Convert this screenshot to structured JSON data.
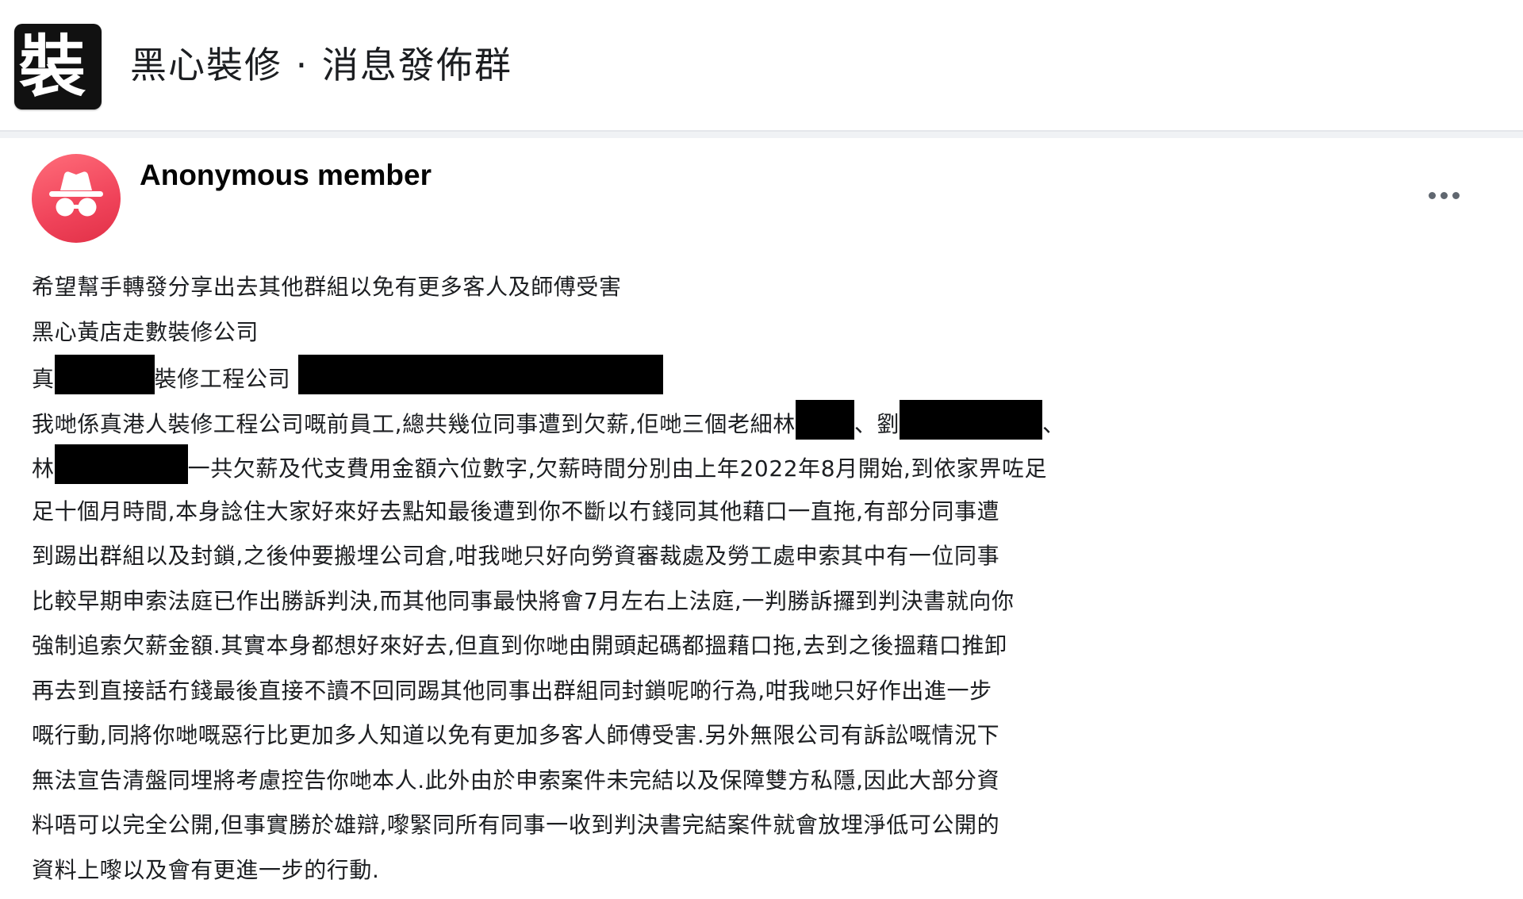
{
  "group": {
    "icon_char": "裝",
    "title": "黑心裝修 · 消息發佈群"
  },
  "post": {
    "author": "Anonymous member",
    "avatar_icon": "incognito-icon",
    "menu_icon": "more-horizontal-icon",
    "lines": [
      "希望幫手轉發分享出去其他群組以免有更多客人及師傅受害",
      "黑心黃店走數裝修公司",
      {
        "a": "真",
        "b": "裝修工程公司",
        "c": ""
      },
      {
        "a": "我哋係真港人裝修工程公司嘅前員工,總共幾位同事遭到欠薪,佢哋三個老細林",
        "b": "、劉",
        "c": "、"
      },
      {
        "a": "林",
        "b": "一共欠薪及代支費用金額六位數字,欠薪時間分別由上年2022年8月開始,到依家畀咗足"
      },
      "足十個月時間,本身諗住大家好來好去點知最後遭到你不斷以冇錢同其他藉口一直拖,有部分同事遭",
      "到踢出群組以及封鎖,之後仲要搬埋公司倉,咁我哋只好向勞資審裁處及勞工處申索其中有一位同事",
      "比較早期申索法庭已作出勝訴判決,而其他同事最快將會7月左右上法庭,一判勝訴攞到判決書就向你",
      "強制追索欠薪金額.其實本身都想好來好去,但直到你哋由開頭起碼都搵藉口拖,去到之後搵藉口推卸",
      "再去到直接話冇錢最後直接不讀不回同踢其他同事出群組同封鎖呢啲行為,咁我哋只好作出進一步",
      "嘅行動,同將你哋嘅惡行比更加多人知道以免有更加多客人師傅受害.另外無限公司有訴訟嘅情況下",
      "無法宣告清盤同埋將考慮控告你哋本人.此外由於申索案件未完結以及保障雙方私隱,因此大部分資",
      "料唔可以完全公開,但事實勝於雄辯,嚟緊同所有同事一收到判決書完結案件就會放埋淨低可公開的",
      "資料上嚟以及會有更進一步的行動."
    ]
  }
}
